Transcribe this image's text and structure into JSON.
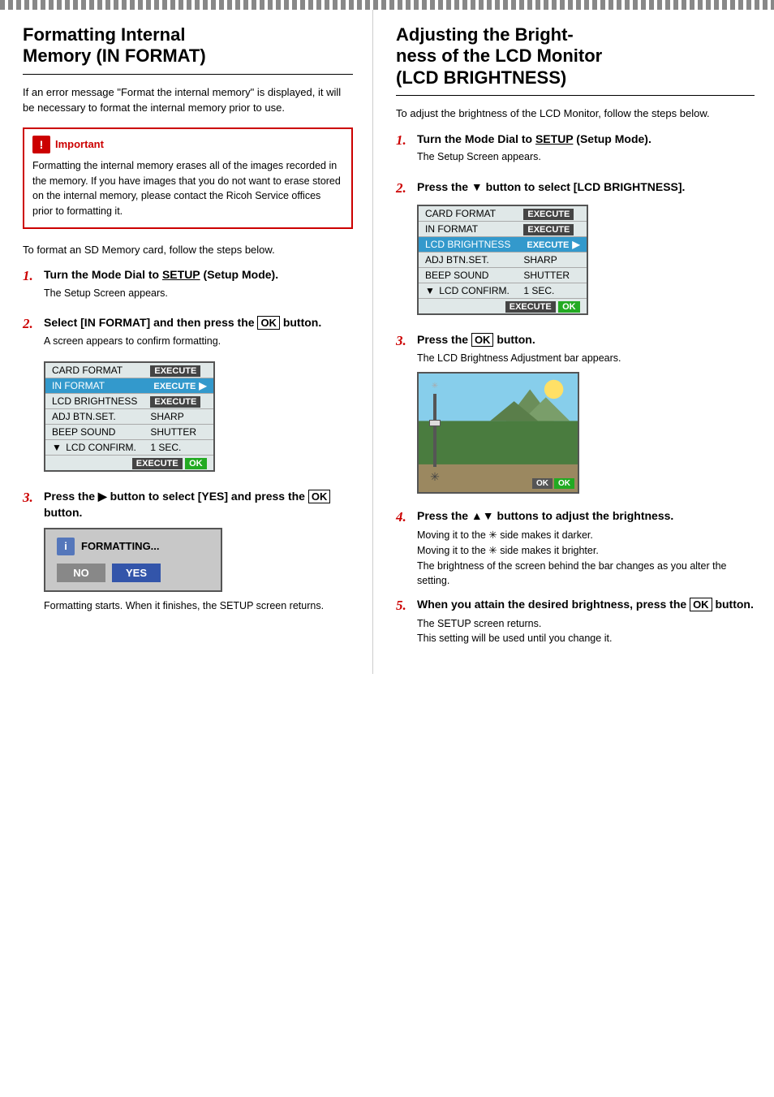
{
  "topBorder": true,
  "left": {
    "title1": "Formatting Internal",
    "title2": "Memory (IN FORMAT)",
    "intro": "If an error message \"Format the internal memory\" is displayed, it will be necessary to format the internal memory prior to use.",
    "important": {
      "label": "Important",
      "text": "Formatting the internal memory erases all of the images recorded in the memory. If you have images that you do not want to erase stored on the internal memory, please contact the Ricoh Service offices prior to formatting it."
    },
    "sdIntro": "To format an SD Memory card, follow the steps below.",
    "steps": [
      {
        "number": "1.",
        "title_parts": [
          "Turn the Mode Dial to ",
          "SETUP",
          " (Setup Mode)."
        ],
        "sub": "The Setup Screen appears."
      },
      {
        "number": "2.",
        "title_parts": [
          "Select  [IN FORMAT] and then press the ",
          "OK",
          " button."
        ],
        "sub": "A screen appears to confirm formatting."
      },
      {
        "number": "3.",
        "title_parts": [
          "Press the ▶ button to select [YES] and press the ",
          "OK",
          " button."
        ]
      }
    ],
    "menuTable": {
      "rows": [
        {
          "left": "CARD FORMAT",
          "right": "EXECUTE",
          "highlight": false,
          "arrowLeft": false
        },
        {
          "left": "IN FORMAT",
          "right": "EXECUTE▶",
          "highlight": true,
          "arrowLeft": false
        },
        {
          "left": "LCD BRIGHTNESS",
          "right": "EXECUTE",
          "highlight": false,
          "arrowLeft": false
        },
        {
          "left": "ADJ BTN.SET.",
          "right": "SHARP",
          "highlight": false,
          "arrowLeft": false
        },
        {
          "left": "BEEP SOUND",
          "right": "SHUTTER",
          "highlight": false,
          "arrowLeft": false
        },
        {
          "left": "LCD CONFIRM.",
          "right": "1 SEC.",
          "highlight": false,
          "arrowLeft": true
        }
      ],
      "footer": "EXECUTE OK"
    },
    "formattingDialog": {
      "icon": "i",
      "label": "FORMATTING...",
      "buttons": [
        "NO",
        "YES"
      ]
    },
    "formatStartText": "Formatting starts. When it finishes, the SETUP screen returns."
  },
  "right": {
    "title1": "Adjusting the Bright-",
    "title2": "ness of the LCD Monitor",
    "title3": "(LCD BRIGHTNESS)",
    "intro": "To adjust the brightness of the LCD Monitor, follow the steps below.",
    "steps": [
      {
        "number": "1.",
        "title_parts": [
          "Turn the Mode Dial to ",
          "SETUP",
          " (Setup Mode)."
        ],
        "sub": "The Setup Screen appears."
      },
      {
        "number": "2.",
        "title_parts": [
          "Press the ▼ button to select [LCD BRIGHTNESS]."
        ]
      },
      {
        "number": "3.",
        "title_parts": [
          "Press the ",
          "OK",
          " button."
        ],
        "sub": "The LCD Brightness Adjustment bar appears."
      },
      {
        "number": "4.",
        "title_parts": [
          "Press the ▲▼ buttons to adjust the brightness."
        ],
        "sub_parts": [
          "Moving it to the ✳ side makes it darker.",
          "Moving it to the ✳ side makes it brighter.",
          "The brightness of the screen behind the bar changes as you alter the setting."
        ]
      },
      {
        "number": "5.",
        "title_parts": [
          "When you attain the desired brightness, press the ",
          "OK",
          " button."
        ],
        "sub_parts": [
          "The SETUP screen returns.",
          "This setting will be used until you change it."
        ]
      }
    ],
    "menuTable": {
      "rows": [
        {
          "left": "CARD FORMAT",
          "right": "EXECUTE",
          "highlight": false,
          "arrowLeft": false
        },
        {
          "left": "IN FORMAT",
          "right": "EXECUTE",
          "highlight": false,
          "arrowLeft": false
        },
        {
          "left": "LCD BRIGHTNESS",
          "right": "EXECUTE▶",
          "highlight": true,
          "arrowLeft": false
        },
        {
          "left": "ADJ BTN.SET.",
          "right": "SHARP",
          "highlight": false,
          "arrowLeft": false
        },
        {
          "left": "BEEP SOUND",
          "right": "SHUTTER",
          "highlight": false,
          "arrowLeft": false
        },
        {
          "left": "LCD CONFIRM.",
          "right": "1 SEC.",
          "highlight": false,
          "arrowLeft": true
        }
      ],
      "footer": "EXECUTE OK"
    }
  }
}
